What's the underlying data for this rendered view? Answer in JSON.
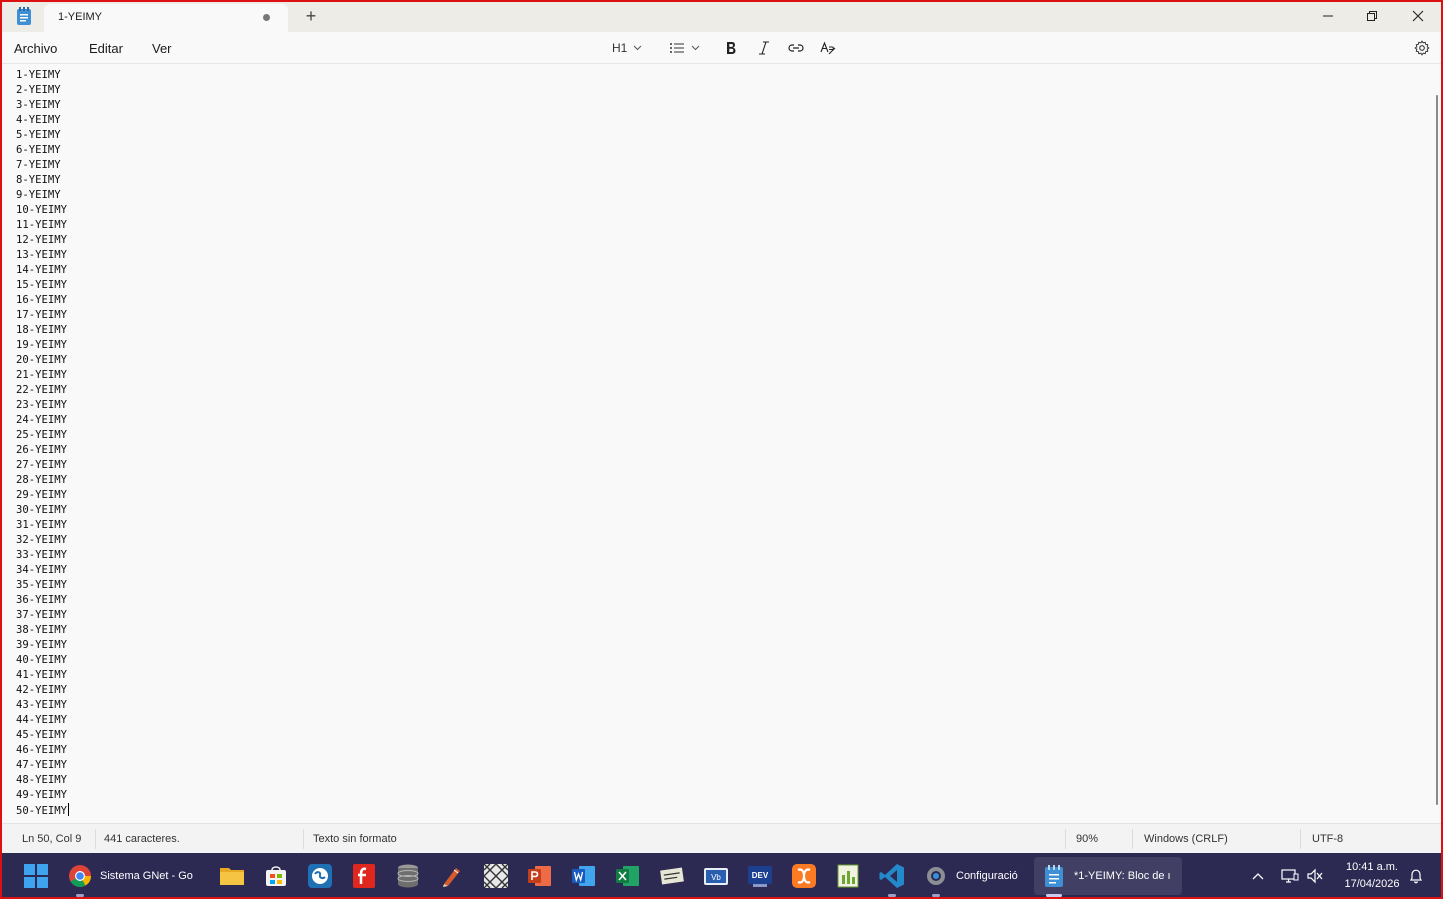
{
  "window": {
    "tab_title": "1-YEIMY",
    "new_tab_symbol": "+"
  },
  "menu": {
    "archivo": "Archivo",
    "editar": "Editar",
    "ver": "Ver"
  },
  "toolbar": {
    "heading_label": "H1",
    "icons": [
      "list-icon",
      "bold-icon",
      "italic-icon",
      "link-icon",
      "clear-format-icon",
      "settings-icon"
    ]
  },
  "editor": {
    "lines": [
      "1-YEIMY",
      "2-YEIMY",
      "3-YEIMY",
      "4-YEIMY",
      "5-YEIMY",
      "6-YEIMY",
      "7-YEIMY",
      "8-YEIMY",
      "9-YEIMY",
      "10-YEIMY",
      "11-YEIMY",
      "12-YEIMY",
      "13-YEIMY",
      "14-YEIMY",
      "15-YEIMY",
      "16-YEIMY",
      "17-YEIMY",
      "18-YEIMY",
      "19-YEIMY",
      "20-YEIMY",
      "21-YEIMY",
      "22-YEIMY",
      "23-YEIMY",
      "24-YEIMY",
      "25-YEIMY",
      "26-YEIMY",
      "27-YEIMY",
      "28-YEIMY",
      "29-YEIMY",
      "30-YEIMY",
      "31-YEIMY",
      "32-YEIMY",
      "33-YEIMY",
      "34-YEIMY",
      "35-YEIMY",
      "36-YEIMY",
      "37-YEIMY",
      "38-YEIMY",
      "39-YEIMY",
      "40-YEIMY",
      "41-YEIMY",
      "42-YEIMY",
      "43-YEIMY",
      "44-YEIMY",
      "45-YEIMY",
      "46-YEIMY",
      "47-YEIMY",
      "48-YEIMY",
      "49-YEIMY",
      "50-YEIMY"
    ]
  },
  "status": {
    "position": "Ln 50, Col 9",
    "chars": "441 caracteres.",
    "format": "Texto sin formato",
    "zoom": "90%",
    "line_ending": "Windows (CRLF)",
    "encoding": "UTF-8"
  },
  "taskbar": {
    "chrome_label": "Sistema GNet - Go",
    "settings_label": "Configuració",
    "notepad_label": "*1-YEIMY: Bloc de ı",
    "time": "10:41 a.m.",
    "date": "17/04/2026"
  },
  "colors": {
    "frame_border": "#dd1111",
    "taskbar_bg": "#2c2a53",
    "editor_bg": "#f9f9f9"
  }
}
